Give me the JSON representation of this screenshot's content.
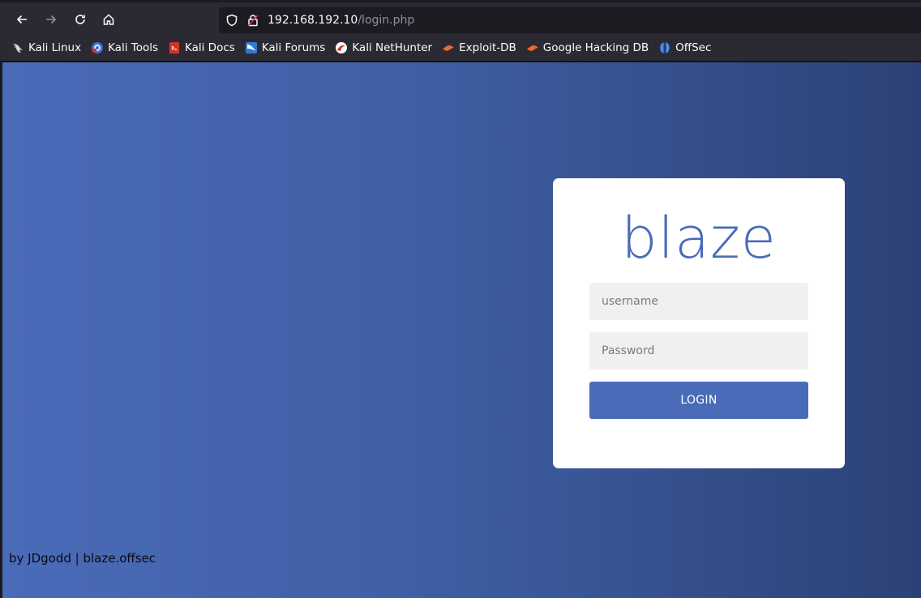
{
  "browser": {
    "url_host": "192.168.192.10",
    "url_path": "/login.php",
    "bookmarks": [
      {
        "label": "Kali Linux",
        "icon": "kali-dragon-icon"
      },
      {
        "label": "Kali Tools",
        "icon": "kali-tools-icon"
      },
      {
        "label": "Kali Docs",
        "icon": "kali-docs-icon"
      },
      {
        "label": "Kali Forums",
        "icon": "kali-forums-icon"
      },
      {
        "label": "Kali NetHunter",
        "icon": "kali-nethunter-icon"
      },
      {
        "label": "Exploit-DB",
        "icon": "exploit-db-icon"
      },
      {
        "label": "Google Hacking DB",
        "icon": "google-hacking-db-icon"
      },
      {
        "label": "OffSec",
        "icon": "offsec-icon"
      }
    ]
  },
  "login": {
    "logo_text": "blaze",
    "username_placeholder": "username",
    "password_placeholder": "Password",
    "button_label": "LOGIN"
  },
  "footer": {
    "text": "by JDgodd | blaze.offsec"
  },
  "colors": {
    "brand": "#4a6bb8",
    "gradient_start": "#4a6bb8",
    "gradient_end": "#2c4276"
  }
}
